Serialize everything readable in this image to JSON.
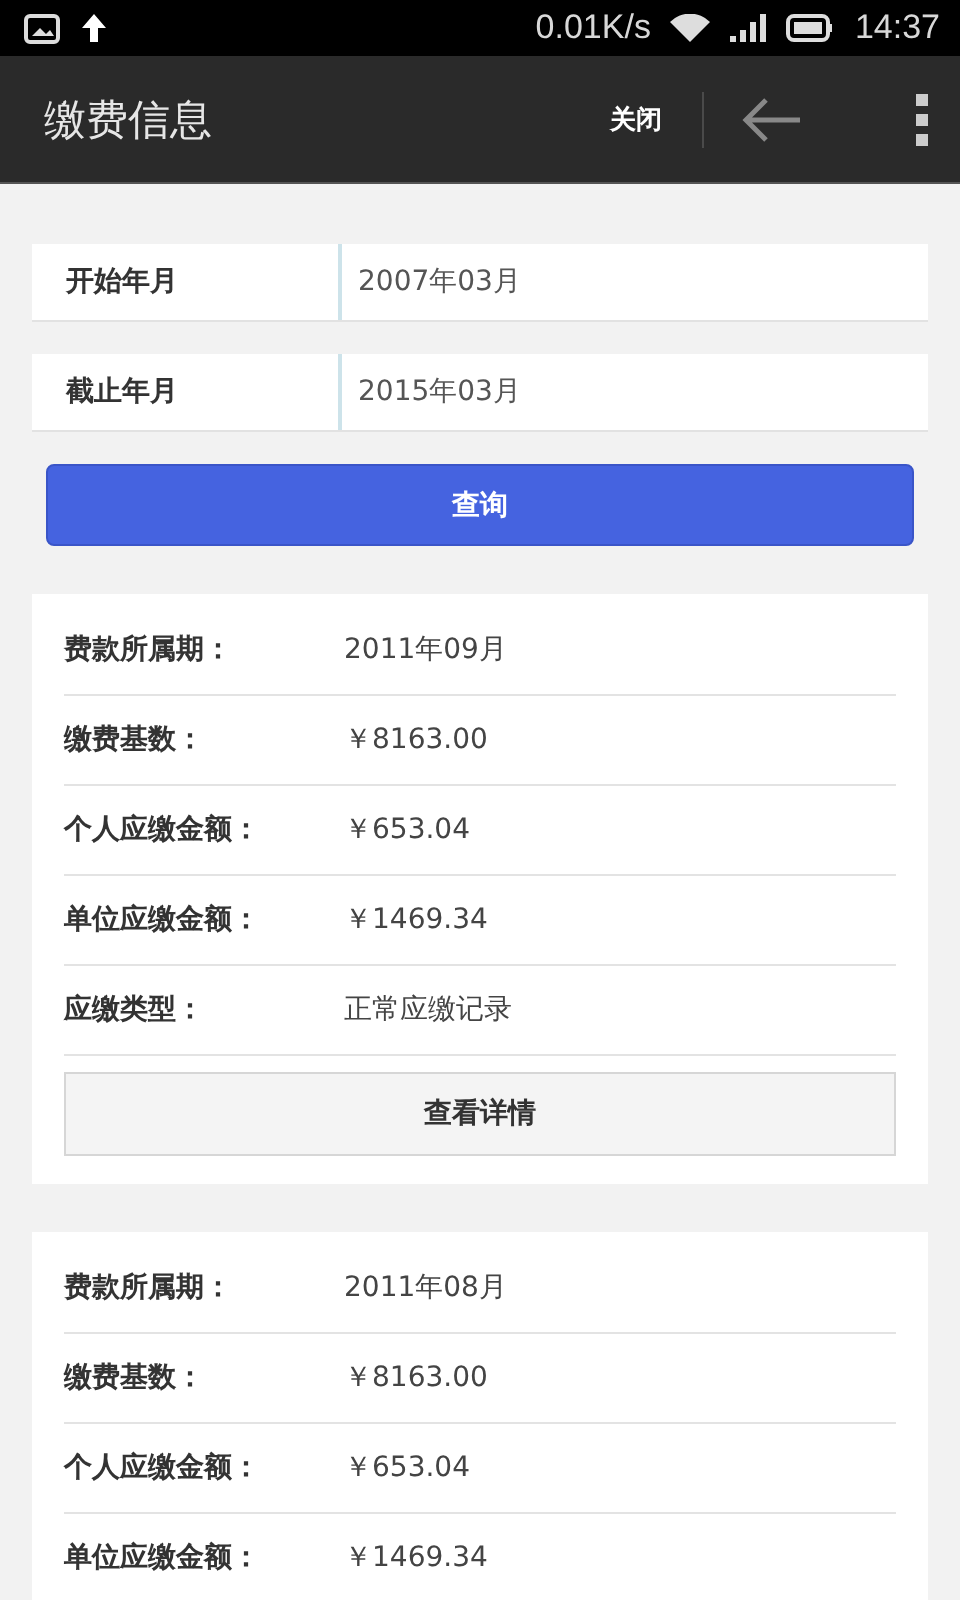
{
  "status_bar": {
    "speed": "0.01K/s",
    "time": "14:37"
  },
  "app_bar": {
    "title": "缴费信息",
    "close": "关闭"
  },
  "form": {
    "fields": [
      {
        "label": "开始年月",
        "value": "2007年03月"
      },
      {
        "label": "截止年月",
        "value": "2015年03月"
      }
    ],
    "submit": "查询"
  },
  "records": [
    {
      "rows": [
        {
          "label": "费款所属期：",
          "value": "2011年09月"
        },
        {
          "label": "缴费基数：",
          "value": "￥8163.00"
        },
        {
          "label": "个人应缴金额：",
          "value": "￥653.04"
        },
        {
          "label": "单位应缴金额：",
          "value": "￥1469.34"
        },
        {
          "label": "应缴类型：",
          "value": "正常应缴记录"
        }
      ],
      "details_button": "查看详情"
    },
    {
      "rows": [
        {
          "label": "费款所属期：",
          "value": "2011年08月"
        },
        {
          "label": "缴费基数：",
          "value": "￥8163.00"
        },
        {
          "label": "个人应缴金额：",
          "value": "￥653.04"
        },
        {
          "label": "单位应缴金额：",
          "value": "￥1469.34"
        }
      ]
    }
  ]
}
